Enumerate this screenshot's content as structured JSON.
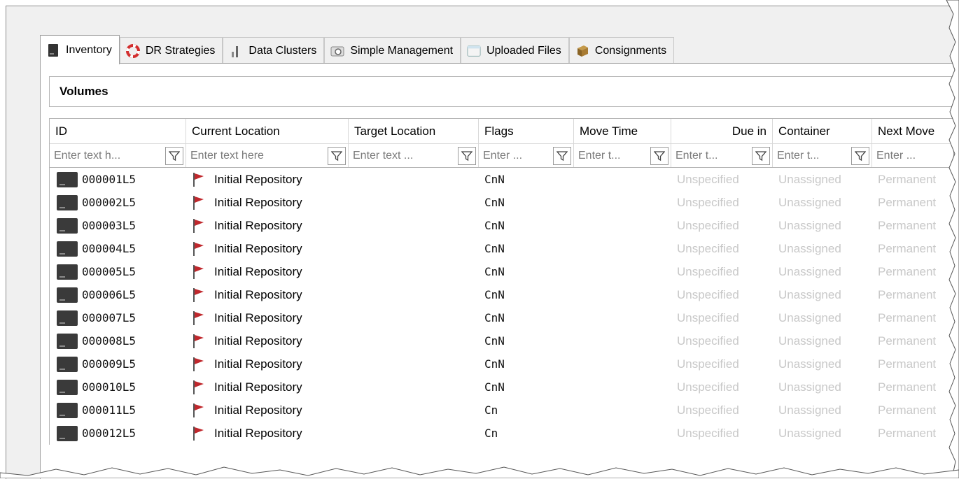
{
  "tabs": [
    {
      "label": "Inventory",
      "icon": "tape-stack-icon",
      "active": true
    },
    {
      "label": "DR Strategies",
      "icon": "lifebuoy-icon",
      "active": false
    },
    {
      "label": "Data Clusters",
      "icon": "data-clusters-icon",
      "active": false
    },
    {
      "label": "Simple Management",
      "icon": "simple-management-icon",
      "active": false
    },
    {
      "label": "Uploaded Files",
      "icon": "uploaded-files-icon",
      "active": false
    },
    {
      "label": "Consignments",
      "icon": "box-icon",
      "active": false
    }
  ],
  "section_title": "Volumes",
  "columns": [
    "ID",
    "Current Location",
    "Target Location",
    "Flags",
    "Move Time",
    "Due in",
    "Container",
    "Next Move"
  ],
  "filters": [
    "Enter text h...",
    "Enter text here",
    "Enter text ...",
    "Enter ...",
    "Enter t...",
    "Enter t...",
    "Enter t...",
    "Enter ..."
  ],
  "rows": [
    {
      "id": "000001L5",
      "location": "Initial Repository",
      "target": "",
      "flags": "CnN",
      "move_time": "",
      "due_in": "Unspecified",
      "container": "Unassigned",
      "next_move": "Permanent"
    },
    {
      "id": "000002L5",
      "location": "Initial Repository",
      "target": "",
      "flags": "CnN",
      "move_time": "",
      "due_in": "Unspecified",
      "container": "Unassigned",
      "next_move": "Permanent"
    },
    {
      "id": "000003L5",
      "location": "Initial Repository",
      "target": "",
      "flags": "CnN",
      "move_time": "",
      "due_in": "Unspecified",
      "container": "Unassigned",
      "next_move": "Permanent"
    },
    {
      "id": "000004L5",
      "location": "Initial Repository",
      "target": "",
      "flags": "CnN",
      "move_time": "",
      "due_in": "Unspecified",
      "container": "Unassigned",
      "next_move": "Permanent"
    },
    {
      "id": "000005L5",
      "location": "Initial Repository",
      "target": "",
      "flags": "CnN",
      "move_time": "",
      "due_in": "Unspecified",
      "container": "Unassigned",
      "next_move": "Permanent"
    },
    {
      "id": "000006L5",
      "location": "Initial Repository",
      "target": "",
      "flags": "CnN",
      "move_time": "",
      "due_in": "Unspecified",
      "container": "Unassigned",
      "next_move": "Permanent"
    },
    {
      "id": "000007L5",
      "location": "Initial Repository",
      "target": "",
      "flags": "CnN",
      "move_time": "",
      "due_in": "Unspecified",
      "container": "Unassigned",
      "next_move": "Permanent"
    },
    {
      "id": "000008L5",
      "location": "Initial Repository",
      "target": "",
      "flags": "CnN",
      "move_time": "",
      "due_in": "Unspecified",
      "container": "Unassigned",
      "next_move": "Permanent"
    },
    {
      "id": "000009L5",
      "location": "Initial Repository",
      "target": "",
      "flags": "CnN",
      "move_time": "",
      "due_in": "Unspecified",
      "container": "Unassigned",
      "next_move": "Permanent"
    },
    {
      "id": "000010L5",
      "location": "Initial Repository",
      "target": "",
      "flags": "CnN",
      "move_time": "",
      "due_in": "Unspecified",
      "container": "Unassigned",
      "next_move": "Permanent"
    },
    {
      "id": "000011L5",
      "location": "Initial Repository",
      "target": "",
      "flags": "Cn",
      "move_time": "",
      "due_in": "Unspecified",
      "container": "Unassigned",
      "next_move": "Permanent"
    },
    {
      "id": "000012L5",
      "location": "Initial Repository",
      "target": "",
      "flags": "Cn",
      "move_time": "",
      "due_in": "Unspecified",
      "container": "Unassigned",
      "next_move": "Permanent"
    }
  ],
  "colors": {
    "flag": "#c0282d",
    "muted_text": "#c8c8c8",
    "volume_icon": "#3a3a3a"
  }
}
